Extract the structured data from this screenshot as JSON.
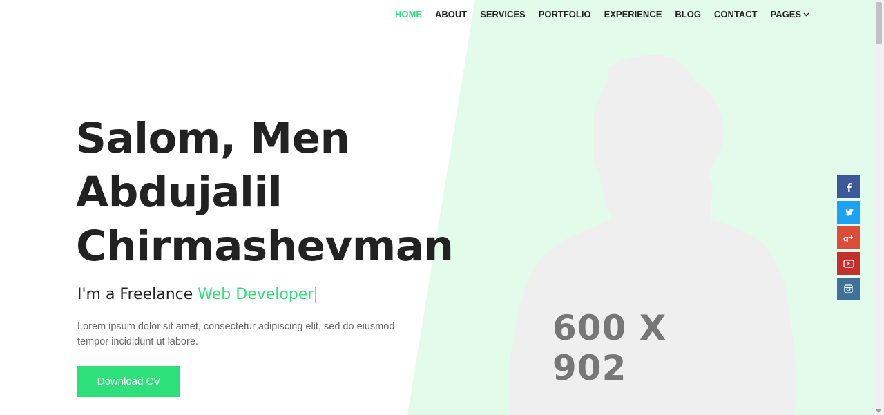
{
  "nav": {
    "items": [
      {
        "label": "HOME",
        "active": true
      },
      {
        "label": "ABOUT"
      },
      {
        "label": "SERVICES"
      },
      {
        "label": "PORTFOLIO"
      },
      {
        "label": "EXPERIENCE"
      },
      {
        "label": "BLOG"
      },
      {
        "label": "CONTACT"
      },
      {
        "label": "PAGES",
        "icon": "chevron-down-icon"
      }
    ]
  },
  "hero": {
    "headline": [
      "Salom, Men",
      "Abdujalil",
      "Chirmashevman"
    ],
    "subtitle_prefix": "I'm a Freelance",
    "subtitle_accent": "Web Developer",
    "description": "Lorem ipsum dolor sit amet, consectetur adipiscing elit, sed do eiusmod tempor incididunt ut labore.",
    "cta_label": "Download CV",
    "image_placeholder": "600 X 902"
  },
  "social": [
    {
      "name": "facebook-icon",
      "glyph": "f",
      "color": "#3b5998"
    },
    {
      "name": "twitter-icon",
      "glyph": "t",
      "color": "#1da1f2"
    },
    {
      "name": "google-plus-icon",
      "glyph": "g+",
      "color": "#dd4b39"
    },
    {
      "name": "youtube-icon",
      "glyph": "yt",
      "color": "#c4302b"
    },
    {
      "name": "instagram-icon",
      "glyph": "ig",
      "color": "#3f729b"
    }
  ],
  "colors": {
    "accent": "#2ee07a",
    "hero_bg": "#e2fbea",
    "text": "#222222"
  }
}
